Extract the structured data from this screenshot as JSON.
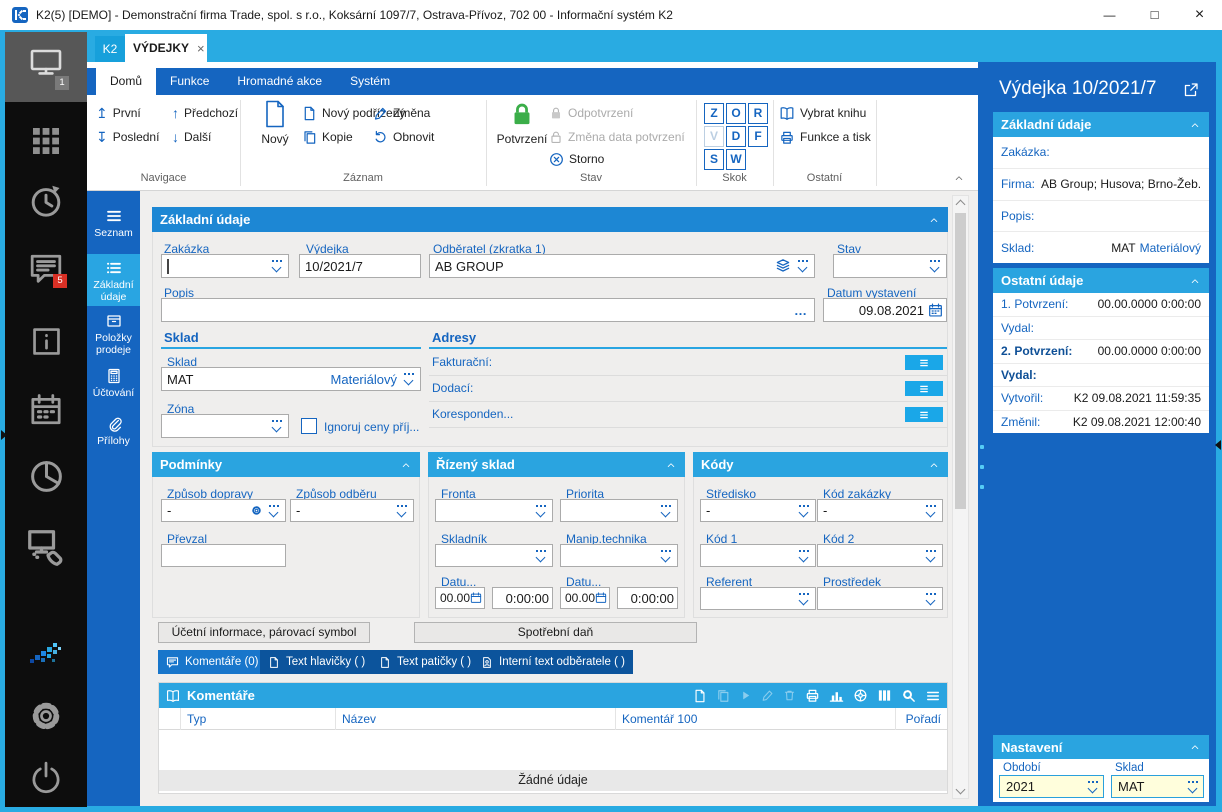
{
  "window": {
    "title": "K2(5) [DEMO] - Demonstrační firma Trade, spol. s r.o., Koksární 1097/7, Ostrava-Přívoz, 702 00 - Informační systém K2",
    "minimize": "—",
    "maximize": "□",
    "close": "×"
  },
  "doc_tabs": {
    "k2": "K2",
    "active": "VÝDEJKY",
    "close": "×"
  },
  "sidebar": {
    "monitor_badge": "1",
    "chat_badge": "5"
  },
  "ribbon": {
    "tabs": {
      "home": "Domů",
      "functions": "Funkce",
      "bulk": "Hromadné akce",
      "system": "Systém"
    },
    "nav": {
      "first": "První",
      "prev": "Předchozí",
      "last": "Poslední",
      "next": "Další",
      "group": "Navigace",
      "first_icon": "↥",
      "prev_icon": "↑",
      "last_icon": "↧",
      "next_icon": "↓"
    },
    "record": {
      "new": "Nový",
      "new_child": "Nový podřízený",
      "copy": "Kopie",
      "change": "Změna",
      "refresh": "Obnovit",
      "group": "Záznam"
    },
    "state": {
      "confirm": "Potvrzení",
      "unconfirm": "Odpotvrzení",
      "change_date": "Změna data potvrzení",
      "cancel": "Storno",
      "group": "Stav"
    },
    "jump": {
      "keys": [
        "Z",
        "O",
        "R",
        "V",
        "D",
        "F",
        "S",
        "W"
      ],
      "group": "Skok"
    },
    "other": {
      "select_book": "Vybrat knihu",
      "func_print": "Funkce a tisk",
      "group": "Ostatní"
    }
  },
  "side_tabs": [
    "Seznam",
    "Základní údaje",
    "Položky prodeje",
    "Účtování",
    "Přílohy"
  ],
  "form": {
    "title": "Základní údaje",
    "zakazka_label": "Zakázka",
    "zakazka_value": "",
    "vydejka_label": "Výdejka",
    "vydejka_value": "10/2021/7",
    "odberatel_label": "Odběratel (zkratka 1)",
    "odberatel_value": "AB GROUP",
    "stav_label": "Stav",
    "stav_value": "",
    "popis_label": "Popis",
    "popis_value": "",
    "popis_more": "…",
    "datum_label": "Datum vystavení",
    "datum_value": "09.08.2021",
    "sklad": {
      "title": "Sklad",
      "sklad_label": "Sklad",
      "sklad_value": "MAT",
      "sklad_value2": "Materiálový",
      "zona_label": "Zóna",
      "checkbox_label": "Ignoruj ceny příj..."
    },
    "adresy": {
      "title": "Adresy",
      "rows": [
        "Fakturační:",
        "Dodací:",
        "Koresponden..."
      ]
    },
    "podminky": {
      "title": "Podmínky",
      "doprava_label": "Způsob dopravy",
      "doprava_value": "-",
      "odber_label": "Způsob odběru",
      "odber_value": "-",
      "prevzal_label": "Převzal",
      "prevzal_value": ""
    },
    "rizeny": {
      "title": "Řízený sklad",
      "fronta": "Fronta",
      "priorita": "Priorita",
      "skladnik": "Skladník",
      "manip": "Manip.technika",
      "datum1_label": "Datu...",
      "datum1_date": "00.00.",
      "datum1_time": "0:00:00",
      "datum2_label": "Datu...",
      "datum2_date": "00.00.",
      "datum2_time": "0:00:00"
    },
    "kody": {
      "title": "Kódy",
      "stredisko_label": "Středisko",
      "stredisko_value": "-",
      "kodzakazky_label": "Kód zakázky",
      "kodzakazky_value": "-",
      "kod1_label": "Kód 1",
      "kod2_label": "Kód 2",
      "referent_label": "Referent",
      "prostredek_label": "Prostředek"
    },
    "btn_ucetni": "Účetní informace, párovací symbol",
    "btn_spotrebni": "Spotřební daň",
    "tabs": [
      "Komentáře (0)",
      "Text hlavičky ( )",
      "Text patičky ( )",
      "Interní text odběratele ( )"
    ],
    "comments": {
      "title": "Komentáře",
      "col_typ": "Typ",
      "col_nazev": "Název",
      "col_komentar": "Komentář 100",
      "col_poradi": "Pořadí",
      "empty": "Žádné údaje"
    }
  },
  "panel": {
    "title": "Výdejka 10/2021/7",
    "zakladni": {
      "title": "Základní údaje",
      "zakazka_label": "Zakázka:",
      "zakazka_value": "",
      "firma_label": "Firma:",
      "firma_value": "AB Group; Husova; Brno-Žeb...",
      "popis_label": "Popis:",
      "popis_value": "",
      "sklad_label": "Sklad:",
      "sklad_value": "MAT",
      "sklad_value2": "Materiálový"
    },
    "ostatni": {
      "title": "Ostatní údaje",
      "p1_label": "1. Potvrzení:",
      "p1_value": "00.00.0000 0:00:00",
      "vydal1_label": "Vydal:",
      "vydal1_value": "",
      "p2_label": "2. Potvrzení:",
      "p2_value": "00.00.0000 0:00:00",
      "vydal2_label": "Vydal:",
      "vydal2_value": "",
      "vytvoril_label": "Vytvořil:",
      "vytvoril_value": "K2 09.08.2021 11:59:35",
      "zmenil_label": "Změnil:",
      "zmenil_value": "K2 09.08.2021 12:00:40"
    },
    "nastaveni": {
      "title": "Nastavení",
      "obdobi_label": "Období",
      "obdobi_value": "2021",
      "sklad_label": "Sklad",
      "sklad_value": "MAT"
    }
  },
  "colors": {
    "accent_cyan": "#29ABE2",
    "dark_blue": "#1565C0",
    "header_blue": "#1D87D4",
    "section_cyan": "#2AA4E0",
    "confirm_green": "#3BAE49",
    "badge_red": "#D93025",
    "field_yellow": "#FFFEDC"
  }
}
